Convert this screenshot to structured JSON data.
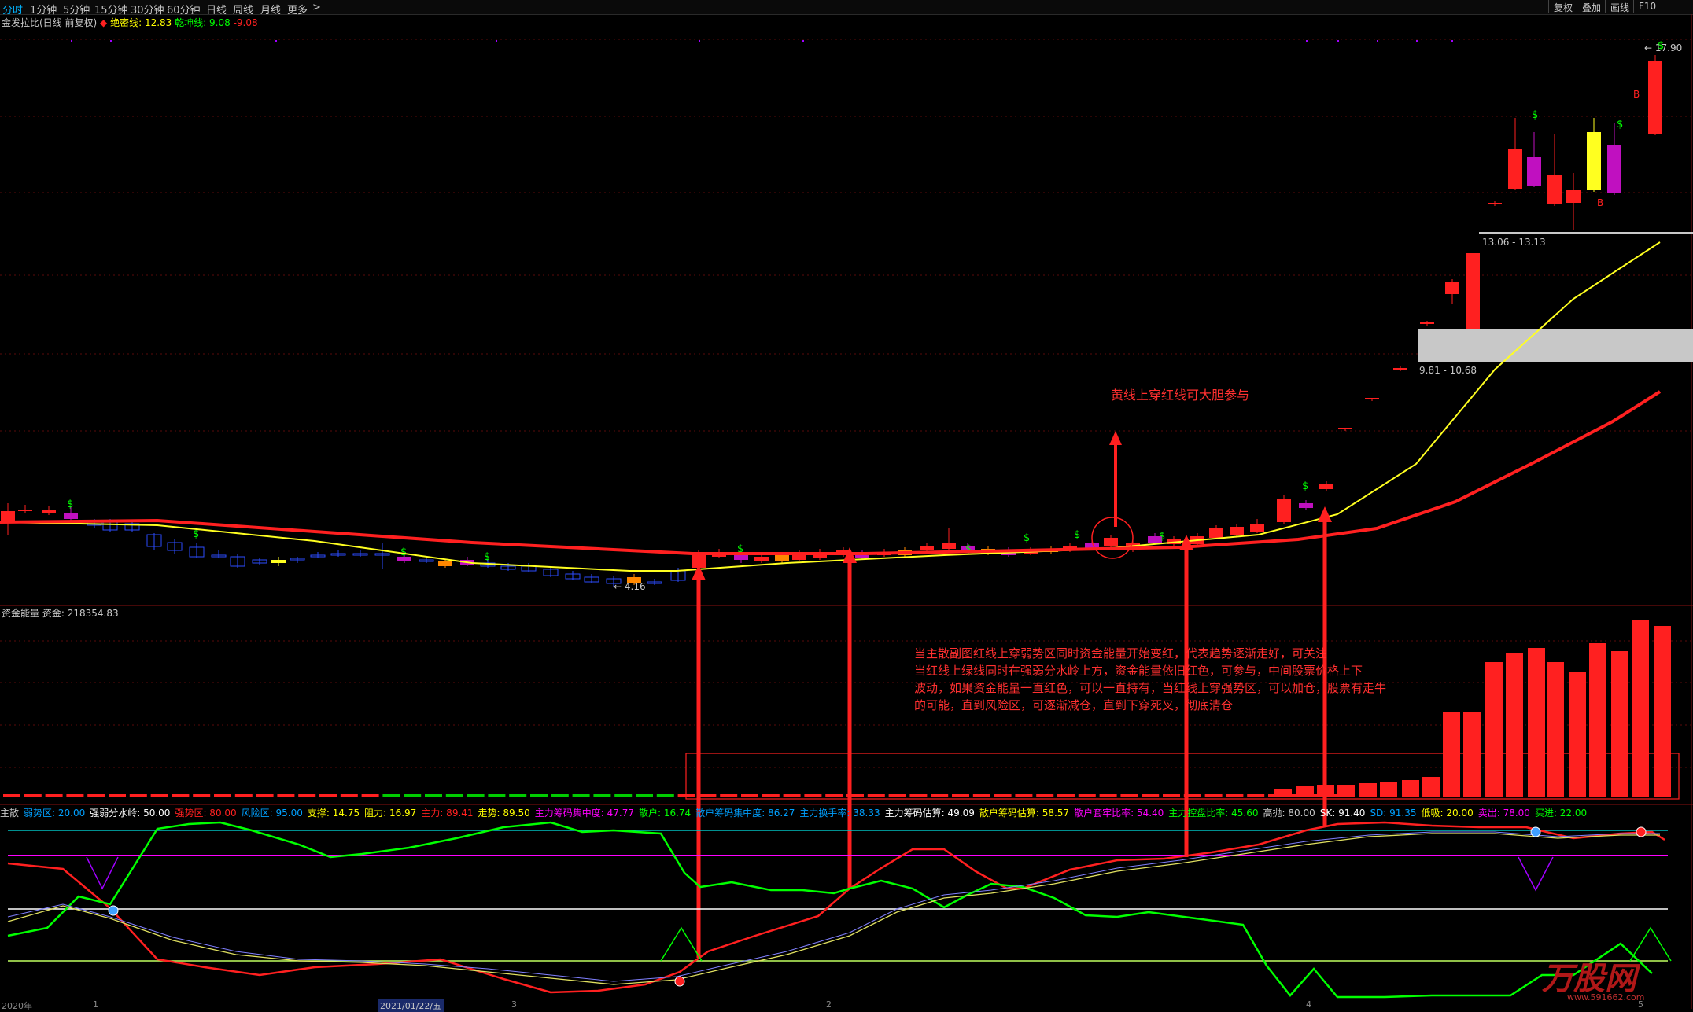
{
  "toolbar": {
    "timeframes": [
      "分时",
      "1分钟",
      "5分钟",
      "15分钟",
      "30分钟",
      "60分钟",
      "日线",
      "周线",
      "月线",
      "更多"
    ],
    "active_index": 0,
    "more_arrow": ">",
    "right_buttons": [
      "复权",
      "叠加",
      "画线",
      "F10"
    ]
  },
  "main_legend": {
    "title": "金发拉比(日线 前复权)",
    "diamond_icon": "diamond-icon",
    "jm_label": "绝密线:",
    "jm_value": "12.83",
    "qk_label": "乾坤线:",
    "qk_value": "9.08",
    "qk_extra": "-9.08"
  },
  "price_labels": {
    "high": "17.90",
    "low": "4.16",
    "zone1": "13.06 - 13.13",
    "zone2": "9.81 - 10.68"
  },
  "annotations": {
    "yellow_cross": "黄线上穿红线可大胆参与",
    "paragraph": [
      "当主散副图红线上穿弱势区同时资金能量开始变红，代表趋势逐渐走好，可关注",
      "当红线上绿线同时在强弱分水岭上方，资金能量依旧红色，可参与，中间股票价格上下",
      "波动，如果资金能量一直红色，可以一直持有，当红线上穿强势区，可以加仓，股票有走牛",
      "的可能，直到风险区，可逐渐减仓，直到下穿死叉，彻底清仓"
    ]
  },
  "energy_legend": {
    "label": "资金能量",
    "fund_label": "资金:",
    "fund_value": "218354.83"
  },
  "indicator_legend": [
    {
      "text": "主散",
      "color": "#c8c8c8"
    },
    {
      "text": "弱势区: 20.00",
      "color": "#00a0ff"
    },
    {
      "text": "强弱分水岭: 50.00",
      "color": "#ffffff"
    },
    {
      "text": "强势区: 80.00",
      "color": "#ff2020"
    },
    {
      "text": "风险区: 95.00",
      "color": "#00a0ff"
    },
    {
      "text": "支撑: 14.75",
      "color": "#ffff00"
    },
    {
      "text": "阻力: 16.97",
      "color": "#ffff00"
    },
    {
      "text": "主力: 89.41",
      "color": "#ff2020"
    },
    {
      "text": "走势: 89.50",
      "color": "#ffff00"
    },
    {
      "text": "主力筹码集中度: 47.77",
      "color": "#ff00ff"
    },
    {
      "text": "散户: 16.74",
      "color": "#00ff00"
    },
    {
      "text": "散户筹码集中度: 86.27",
      "color": "#00a0ff"
    },
    {
      "text": "主力换手率: 38.33",
      "color": "#00a0ff"
    },
    {
      "text": "主力筹码估算: 49.09",
      "color": "#ffffff"
    },
    {
      "text": "散户筹码估算: 58.57",
      "color": "#ffff00"
    },
    {
      "text": "散户套牢比率: 54.40",
      "color": "#ff00ff"
    },
    {
      "text": "主力控盘比率: 45.60",
      "color": "#00ff00"
    },
    {
      "text": "高抛: 80.00",
      "color": "#c8c8c8"
    },
    {
      "text": "SK: 91.40",
      "color": "#ffffff"
    },
    {
      "text": "SD: 91.35",
      "color": "#00a0ff"
    },
    {
      "text": "低吸: 20.00",
      "color": "#ffff00"
    },
    {
      "text": "卖出: 78.00",
      "color": "#ff00ff"
    },
    {
      "text": "买进: 22.00",
      "color": "#00ff00"
    }
  ],
  "axis_labels": {
    "year": "2020年",
    "tick1": "1",
    "date": "2021/01/22/五",
    "tick2": "3",
    "tick3": "2",
    "tick4": "4",
    "tick5": "5"
  },
  "watermark": {
    "text": "万股网",
    "url": "www.591662.com"
  },
  "colors": {
    "up": "#ff2020",
    "down_blue": "#2c4cff",
    "ma_yellow": "#ffff20",
    "ma_red": "#ff2020",
    "energy_green": "#00cc00",
    "magenta": "#c010c0"
  }
}
